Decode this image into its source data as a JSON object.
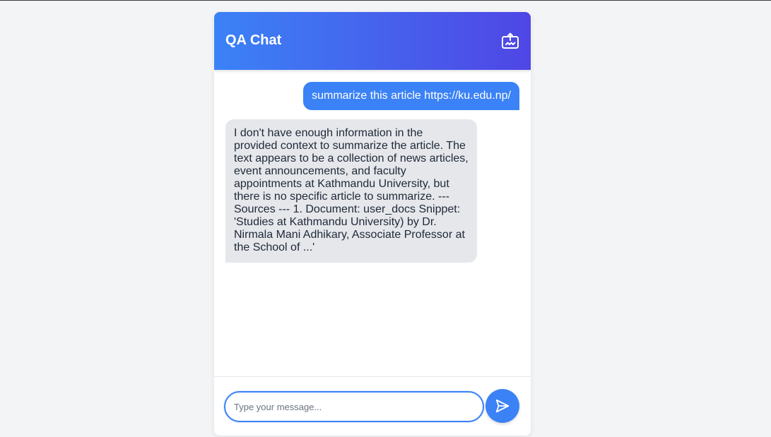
{
  "header": {
    "title": "QA Chat",
    "icon": "new-chat-icon"
  },
  "messages": [
    {
      "role": "user",
      "text": "summarize this article https://ku.edu.np/"
    },
    {
      "role": "assistant",
      "text": "I don't have enough information in the provided context to summarize the article. The text appears to be a collection of news articles, event announcements, and faculty appointments at Kathmandu University, but there is no specific article to summarize. --- Sources --- 1. Document: user_docs Snippet: 'Studies at Kathmandu University) by Dr. Nirmala Mani Adhikary, Associate Professor at the School of ...'"
    }
  ],
  "input": {
    "value": "",
    "placeholder": "Type your message..."
  },
  "send": {
    "icon": "send-icon"
  },
  "colors": {
    "header_start": "#3b82f6",
    "header_end": "#4f46e5",
    "user_bubble": "#3b82f6",
    "assistant_bubble": "#e5e7eb",
    "send_button": "#3b82f6"
  }
}
